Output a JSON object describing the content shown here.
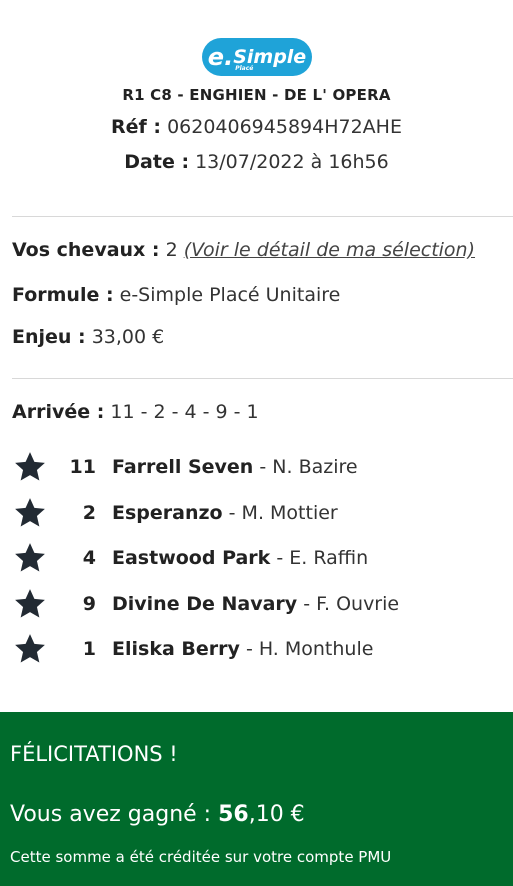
{
  "logo": {
    "e": "e.",
    "main": "Simple",
    "sub": "Placé"
  },
  "ticket": {
    "race": "R1 C8 - ENGHIEN - DE L' OPERA",
    "ref_label": "Réf :",
    "ref_value": "0620406945894H72AHE",
    "date_label": "Date :",
    "date_value": "13/07/2022 à 16h56"
  },
  "bet": {
    "horses_label": "Vos chevaux :",
    "horses_value": "2",
    "detail_link": "(Voir le détail de ma sélection)",
    "formula_label": "Formule :",
    "formula_value": "e-Simple Placé Unitaire",
    "stake_label": "Enjeu :",
    "stake_value": "33,00 €"
  },
  "finish": {
    "label": "Arrivée :",
    "value": "11 - 2 - 4 - 9 - 1",
    "runners": [
      {
        "number": "11",
        "horse": "Farrell Seven",
        "jockey": "- N. Bazire"
      },
      {
        "number": "2",
        "horse": "Esperanzo",
        "jockey": "- M. Mottier"
      },
      {
        "number": "4",
        "horse": "Eastwood Park",
        "jockey": "- E. Raffin"
      },
      {
        "number": "9",
        "horse": "Divine De Navary",
        "jockey": "- F. Ouvrie"
      },
      {
        "number": "1",
        "horse": "Eliska Berry",
        "jockey": "- H. Monthule"
      }
    ]
  },
  "result": {
    "congrats": "FÉLICITATIONS !",
    "won_prefix": "Vous avez gagné :",
    "won_amount_int": "56",
    "won_amount_dec": ",10 €",
    "credit_note": "Cette somme a été créditée sur votre compte PMU"
  },
  "colors": {
    "logo_blue": "#1fa3d8",
    "banner_green": "#006b2c",
    "star": "#222a33"
  }
}
